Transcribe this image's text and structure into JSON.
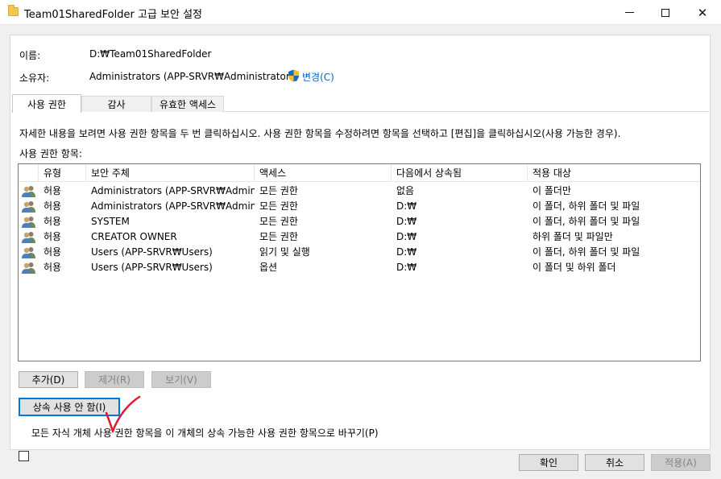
{
  "window": {
    "title": "Team01SharedFolder 고급 보안 설정",
    "minimize_glyph": "",
    "maximize_glyph": "",
    "close_glyph": "✕"
  },
  "info": {
    "name_label": "이름:",
    "name_value": "D:₩Team01SharedFolder",
    "owner_label": "소유자:",
    "owner_value": "Administrators (APP-SRVR₩Administrators)",
    "change_link": "변경(C)"
  },
  "tabs": [
    {
      "label": "사용 권한",
      "active": true
    },
    {
      "label": "감사",
      "active": false
    },
    {
      "label": "유효한 액세스",
      "active": false
    }
  ],
  "description": "자세한 내용을 보려면 사용 권한 항목을 두 번 클릭하십시오. 사용 권한 항목을 수정하려면 항목을 선택하고 [편집]을 클릭하십시오(사용 가능한 경우).",
  "entries_label": "사용 권한 항목:",
  "table": {
    "columns": [
      "유형",
      "보안 주체",
      "액세스",
      "다음에서 상속됨",
      "적용 대상"
    ],
    "rows": [
      [
        "허용",
        "Administrators (APP-SRVR₩Admini...",
        "모든 권한",
        "없음",
        "이 폴더만"
      ],
      [
        "허용",
        "Administrators (APP-SRVR₩Admini...",
        "모든 권한",
        "D:₩",
        "이 폴더, 하위 폴더 및 파일"
      ],
      [
        "허용",
        "SYSTEM",
        "모든 권한",
        "D:₩",
        "이 폴더, 하위 폴더 및 파일"
      ],
      [
        "허용",
        "CREATOR OWNER",
        "모든 권한",
        "D:₩",
        "하위 폴더 및 파일만"
      ],
      [
        "허용",
        "Users (APP-SRVR₩Users)",
        "읽기 및 실행",
        "D:₩",
        "이 폴더, 하위 폴더 및 파일"
      ],
      [
        "허용",
        "Users (APP-SRVR₩Users)",
        "옵션",
        "D:₩",
        "이 폴더 및 하위 폴더"
      ]
    ]
  },
  "buttons": {
    "add": "추가(D)",
    "remove": "제거(R)",
    "view": "보기(V)",
    "disable_inheritance": "상속 사용 안 함(I)",
    "ok": "확인",
    "cancel": "취소",
    "apply": "적용(A)"
  },
  "replace_checkbox_label": "모든 자식 개체 사용 권한 항목을 이 개체의 상속 가능한 사용 권한 항목으로 바꾸기(P)",
  "replace_checkbox_checked": false,
  "colors": {
    "accent": "#0078d7",
    "link": "#0066cc",
    "annotation": "#e0192f"
  }
}
